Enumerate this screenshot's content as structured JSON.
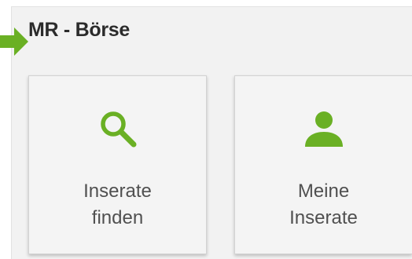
{
  "header": {
    "title": "MR - Börse"
  },
  "tiles": [
    {
      "label": "Inserate\nfinden",
      "icon": "search-icon"
    },
    {
      "label": "Meine\nInserate",
      "icon": "user-icon"
    }
  ],
  "colors": {
    "accent": "#6ab024",
    "panel_bg": "#f2f2f2",
    "tile_bg": "#f4f4f4",
    "title_text": "#2b2b2b",
    "label_text": "#505050"
  }
}
